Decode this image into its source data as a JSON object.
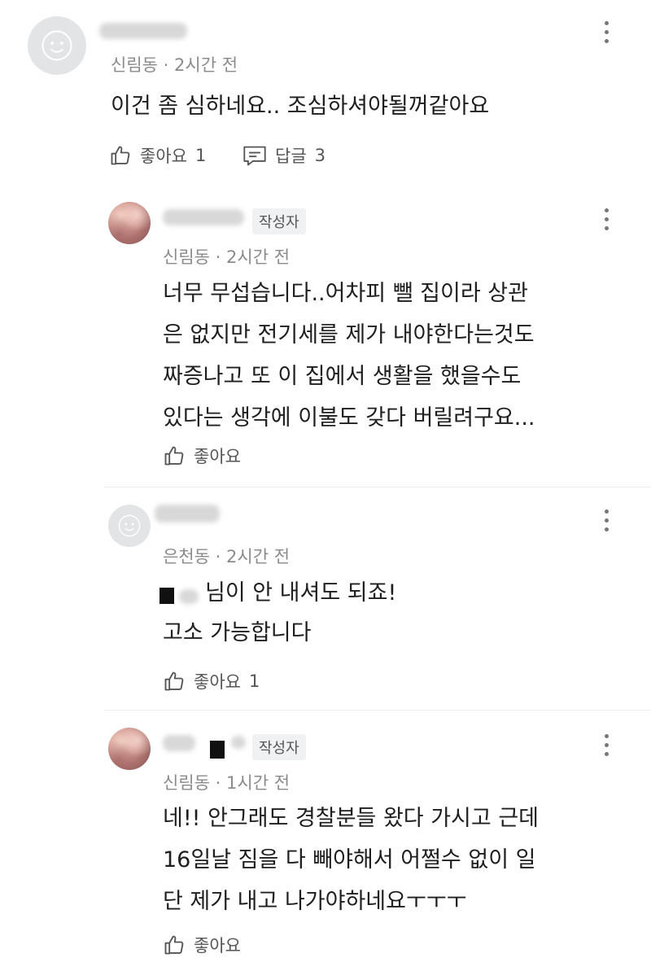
{
  "comments": [
    {
      "location": "신림동",
      "time": "2시간 전",
      "lines": [
        "이건 좀 심하네요.. 조심하셔야될꺼같아요"
      ],
      "like_label": "좋아요",
      "like_count": "1",
      "reply_label": "답글",
      "reply_count": "3",
      "avatar_icon": "default-avatar-icon"
    },
    {
      "badge": "작성자",
      "location": "신림동",
      "time": "2시간 전",
      "lines": [
        "너무 무섭습니다..어차피 뺄 집이라 상관",
        "은 없지만 전기세를 제가 내야한다는것도",
        "짜증나고 또 이 집에서 생활을 했을수도",
        "있다는 생각에 이불도 갖다 버릴려구요..."
      ],
      "like_label": "좋아요",
      "avatar_icon": "profile-photo-icon"
    },
    {
      "location": "은천동",
      "time": "2시간 전",
      "lines": [
        "님이 안 내셔도 되죠!",
        "고소 가능합니다"
      ],
      "like_label": "좋아요",
      "like_count": "1",
      "avatar_icon": "default-avatar-icon"
    },
    {
      "badge": "작성자",
      "location": "신림동",
      "time": "1시간 전",
      "lines": [
        "네!! 안그래도 경찰분들 왔다 가시고 근데",
        "16일날 짐을 다 빼야해서 어쩔수 없이 일",
        "단 제가 내고 나가야하네요ㅜㅜㅜ"
      ],
      "like_label": "좋아요",
      "avatar_icon": "profile-photo-icon"
    }
  ],
  "icons": {
    "like": "thumbs-up-icon",
    "reply": "comment-icon",
    "more": "more-vertical-icon"
  }
}
